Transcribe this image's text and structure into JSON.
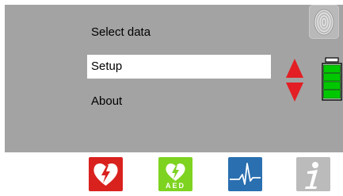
{
  "menu": {
    "items": [
      {
        "label": "Select data",
        "selected": false
      },
      {
        "label": "Setup",
        "selected": true
      },
      {
        "label": "About",
        "selected": false
      }
    ]
  },
  "battery": {
    "level_bars": 4,
    "max_bars": 4,
    "color": "#00c800"
  },
  "colors": {
    "screen_bg": "#a3a3a3",
    "arrow_red": "#e31e24",
    "heart_red": "#d9211e",
    "aed_green": "#7ed321",
    "ecg_blue": "#2a6fb0",
    "info_grey": "#bbbbbb"
  },
  "icons": {
    "aed_label": "AED"
  }
}
